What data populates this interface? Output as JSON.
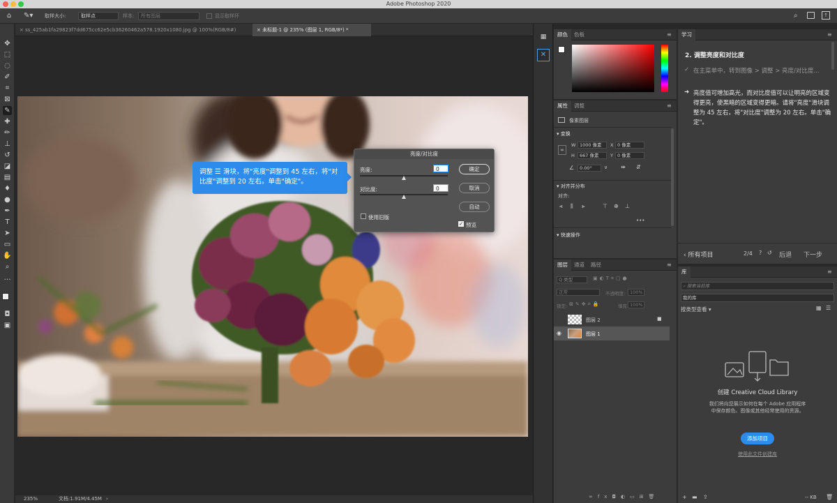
{
  "app": {
    "window_title": "Adobe Photoshop 2020"
  },
  "options_bar": {
    "sample_size_label": "取样大小:",
    "sample_size_value": "取样点",
    "sample_label": "样本:",
    "sample_value": "所有图层",
    "show_ring_label": "显示取样环"
  },
  "tabs": [
    {
      "label": "ss_425ab1fa29823f7dd675cc62e5cb36260462a578.1920x1080.jpg @ 100%(RGB/8#)",
      "active": false
    },
    {
      "label": "未标题-1 @ 235% (图层 1, RGB/8*) *",
      "active": true
    }
  ],
  "status": {
    "zoom": "235%",
    "doc_size": "文档:1.91M/4.45M"
  },
  "callout": {
    "text_before_icon": "调整",
    "text_after_icon": "滑块，将\"亮度\"调整到 45 左右，将\"对比度\"调整到 20 左右。单击\"确定\"。"
  },
  "dialog": {
    "title": "亮度/对比度",
    "brightness_label": "亮度:",
    "brightness_value": "0",
    "contrast_label": "对比度:",
    "contrast_value": "0",
    "ok": "确定",
    "cancel": "取消",
    "auto": "自动",
    "legacy_label": "使用旧版",
    "legacy_checked": false,
    "preview_label": "预览",
    "preview_checked": true
  },
  "color_panel": {
    "tabs": [
      "颜色",
      "色板"
    ]
  },
  "properties_panel": {
    "tabs": [
      "属性",
      "调整"
    ],
    "layer_type": "像素图层",
    "transform_title": "变换",
    "w_label": "W",
    "w_value": "1000 像素",
    "x_label": "X",
    "x_value": "0 像素",
    "h_label": "H",
    "h_value": "667 像素",
    "y_label": "Y",
    "y_value": "0 像素",
    "angle_value": "0.00°",
    "align_title": "对齐并分布",
    "align_label": "对齐:",
    "more": "•••",
    "quick_actions_title": "快速操作"
  },
  "layers_panel": {
    "tabs": [
      "图层",
      "通道",
      "路径"
    ],
    "filter_kind": "Q 类型",
    "blend_mode": "正常",
    "opacity_label": "不透明度:",
    "opacity_value": "100%",
    "lock_label": "锁定:",
    "fill_label": "填充:",
    "fill_value": "100%",
    "layers": [
      {
        "name": "图层 2",
        "visible": false,
        "locked": true,
        "selected": false
      },
      {
        "name": "图层 1",
        "visible": true,
        "locked": false,
        "selected": true
      }
    ]
  },
  "learn_panel": {
    "tab": "学习",
    "step_title": "2. 调整亮度和对比度",
    "step1": "在主菜单中，转到图像 > 调整 > 亮度/对比度...",
    "step2": "亮度值可增加高光，而对比度值可以让明亮的区域变得更亮，使黑暗的区域变得更暗。请将\"亮度\"滑块调整为 45 左右，将\"对比度\"调整为 20 左右。单击\"确定\"。",
    "all_projects": "所有项目",
    "progress": "2/4",
    "back": "后退",
    "next": "下一步"
  },
  "library_panel": {
    "tab": "库",
    "search_placeholder": "搜索当前库",
    "library_name": "我的库",
    "view_by": "按类型查看",
    "create_title": "创建 Creative Cloud Library",
    "description": "我们将向您展示如何在每个 Adobe 应用程序中保存颜色、图像或其他经常使用的资源。",
    "add_button": "添加项目",
    "create_from_file": "使用此文件创建库",
    "footer_size": "-- KB"
  },
  "colors": {
    "accent": "#2d8ceb",
    "panel_bg": "#3c3c3c",
    "canvas_bg": "#282828"
  }
}
